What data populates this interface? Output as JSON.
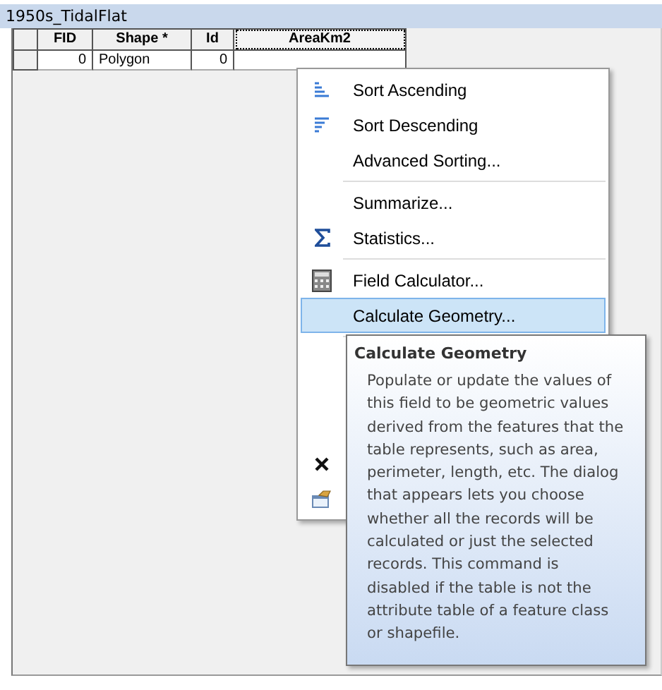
{
  "window": {
    "title": "1950s_TidalFlat"
  },
  "table": {
    "columns": [
      {
        "label": "FID",
        "selected": false
      },
      {
        "label": "Shape *",
        "selected": false
      },
      {
        "label": "Id",
        "selected": false
      },
      {
        "label": "AreaKm2",
        "selected": true
      }
    ],
    "rows": [
      {
        "cells": [
          "0",
          "Polygon",
          "0",
          ""
        ]
      }
    ]
  },
  "menu": {
    "items": [
      {
        "kind": "ascending",
        "label": "Sort Ascending",
        "selected": false
      },
      {
        "kind": "descending",
        "label": "Sort Descending",
        "selected": false
      },
      {
        "kind": "plain",
        "label": "Advanced Sorting...",
        "selected": false
      },
      {
        "kind": "separator"
      },
      {
        "kind": "plain",
        "label": "Summarize...",
        "selected": false
      },
      {
        "kind": "statistics",
        "label": "Statistics...",
        "selected": false
      },
      {
        "kind": "separator"
      },
      {
        "kind": "calculator",
        "label": "Field Calculator...",
        "selected": false
      },
      {
        "kind": "plain",
        "label": "Calculate Geometry...",
        "selected": true
      },
      {
        "kind": "separator"
      },
      {
        "kind": "covered"
      },
      {
        "kind": "covered"
      },
      {
        "kind": "covered"
      },
      {
        "kind": "delete"
      },
      {
        "kind": "properties"
      }
    ]
  },
  "tooltip": {
    "title": "Calculate Geometry",
    "text": "Populate or update the values of this field to be geometric values derived from the features that the table represents, such as area, perimeter, length, etc. The dialog that appears lets you choose whether all the records will be calculated or just the selected records. This command is disabled if the table is not the attribute table of a feature class or shapefile."
  }
}
